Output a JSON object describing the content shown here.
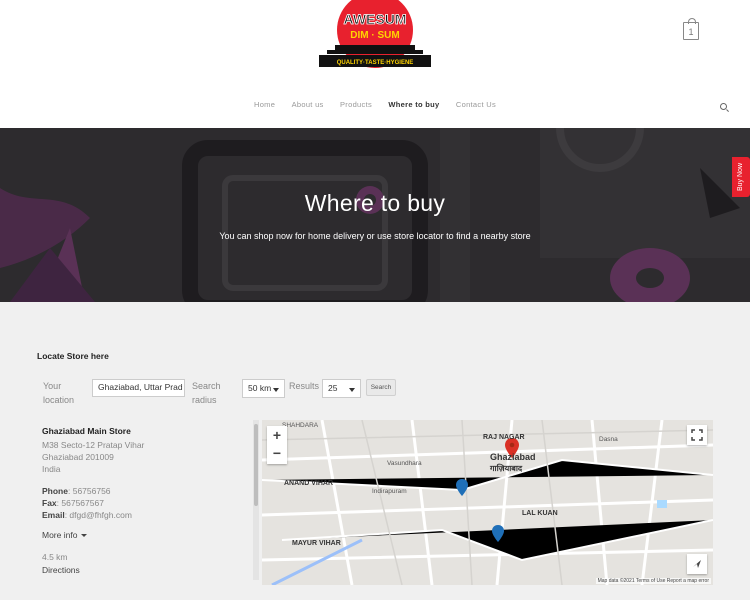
{
  "brand": {
    "logo_text_1": "AWESUM",
    "logo_text_2": "DIM · SUM",
    "tagline": "QUALITY·TASTE·HYGIENE",
    "color": "#e8212e"
  },
  "cart": {
    "count": "1"
  },
  "nav": {
    "items": [
      "Home",
      "About us",
      "Products",
      "Where to buy",
      "Contact Us"
    ],
    "active": "Where to buy"
  },
  "hero": {
    "title": "Where to buy",
    "subtitle": "You can shop now for home delivery or use store locator to find a nearby store"
  },
  "buy_now": "Buy Now",
  "locator": {
    "title": "Locate Store here",
    "your_location_label": "Your location",
    "location_value": "Ghaziabad, Uttar Prad",
    "radius_label": "Search radius",
    "radius_value": "50 km",
    "results_label": "Results",
    "results_value": "25",
    "search_button": "Search"
  },
  "store": {
    "name": "Ghaziabad Main Store",
    "address_1": "M38 Secto-12 Pratap Vihar",
    "address_2": "Ghaziabad 201009",
    "country": "India",
    "phone_label": "Phone",
    "phone": "56756756",
    "fax_label": "Fax",
    "fax": "567567567",
    "email_label": "Email",
    "email": "dfgd@fhfgh.com",
    "more_info": "More info",
    "distance": "4.5 km",
    "directions": "Directions"
  },
  "map": {
    "labels": [
      "SHAHDARA",
      "ANAND VIHAR",
      "MAYUR VIHAR",
      "RAJ NAGAR",
      "Ghaziabad",
      "गाज़ियाबाद",
      "LAL KUAN",
      "Indirapuram",
      "Vasundhara",
      "Dasna"
    ],
    "footer": "Map data ©2021   Terms of Use   Report a map error",
    "zoom_in": "+",
    "zoom_out": "−"
  }
}
